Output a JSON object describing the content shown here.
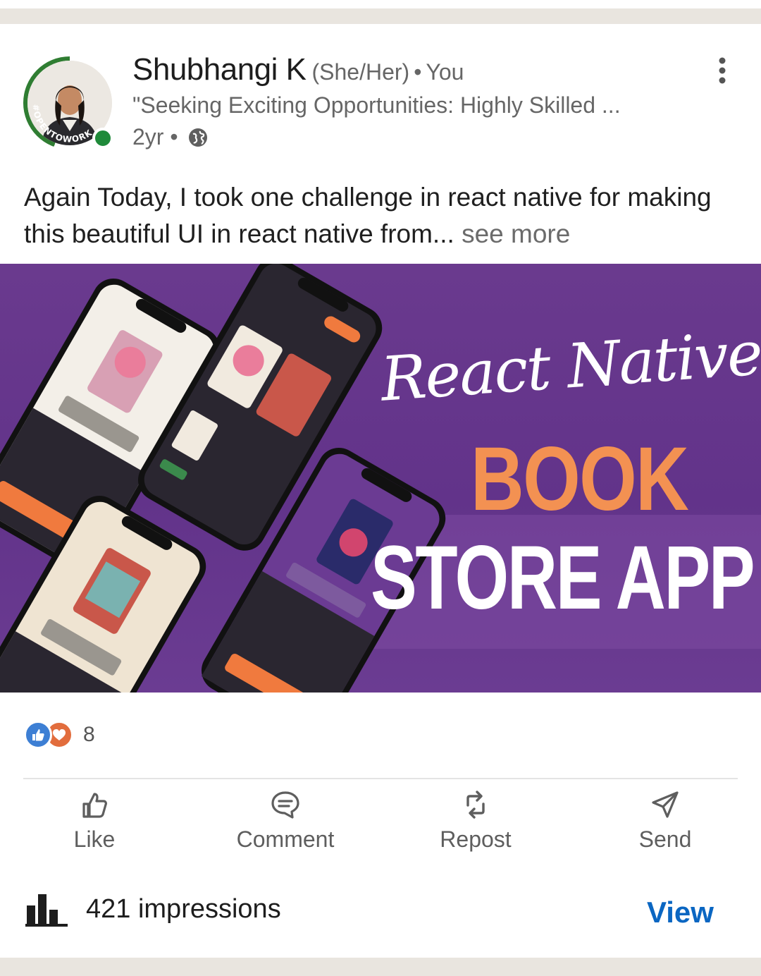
{
  "post": {
    "author": {
      "name": "Shubhangi K",
      "pronouns": "(She/Her)",
      "separator": "•",
      "relation": "You",
      "headline": "\"Seeking Exciting Opportunities: Highly Skilled ...",
      "time": "2yr •",
      "avatar_badge": "#OPENTOWORK",
      "visibility_icon": "globe-icon"
    },
    "text": "Again Today, I took one challenge in react native for making this beautiful UI in react native from...",
    "see_more": "see more",
    "image": {
      "script_title": "React Native",
      "title_line1": "BOOK",
      "title_line2": "STORE APP"
    },
    "reactions": {
      "count": "8",
      "types": [
        "like",
        "love"
      ]
    },
    "actions": {
      "like": "Like",
      "comment": "Comment",
      "repost": "Repost",
      "send": "Send"
    },
    "impressions": {
      "label": "421 impressions",
      "view": "View"
    }
  },
  "colors": {
    "accent": "#0a66c2",
    "banner": "#62338a",
    "orange": "#f39152",
    "open_to_work": "#2f7d32"
  }
}
